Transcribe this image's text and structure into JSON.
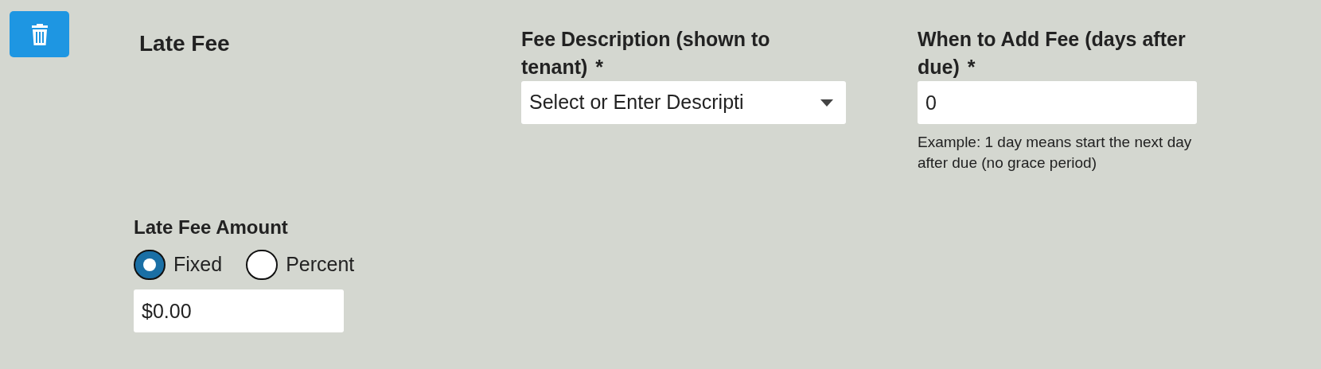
{
  "title": "Late Fee",
  "description": {
    "label": "Fee Description (shown to tenant)",
    "required_mark": "*",
    "placeholder": "Select or Enter Descripti"
  },
  "days_after_due": {
    "label": "When to Add Fee (days after due)",
    "required_mark": "*",
    "value": "0",
    "help": "Example: 1 day means start the next day after due (no grace period)"
  },
  "amount": {
    "label": "Late Fee Amount",
    "options": [
      {
        "label": "Fixed",
        "selected": true
      },
      {
        "label": "Percent",
        "selected": false
      }
    ],
    "value": "$0.00"
  }
}
